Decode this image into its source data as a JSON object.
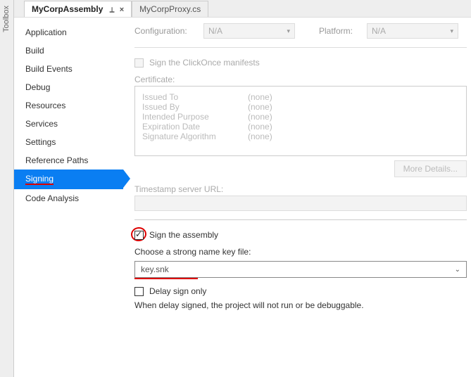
{
  "toolbox_label": "Toolbox",
  "tabs": [
    {
      "label": "MyCorpAssembly",
      "active": true,
      "pinned": true
    },
    {
      "label": "MyCorpProxy.cs",
      "active": false,
      "pinned": false
    }
  ],
  "sidebar": {
    "items": [
      "Application",
      "Build",
      "Build Events",
      "Debug",
      "Resources",
      "Services",
      "Settings",
      "Reference Paths",
      "Signing",
      "Code Analysis"
    ],
    "selected": "Signing"
  },
  "config": {
    "configuration_label": "Configuration:",
    "configuration_value": "N/A",
    "platform_label": "Platform:",
    "platform_value": "N/A"
  },
  "clickonce": {
    "sign_label": "Sign the ClickOnce manifests",
    "certificate_label": "Certificate:",
    "cert": {
      "issued_to_label": "Issued To",
      "issued_to_value": "(none)",
      "issued_by_label": "Issued By",
      "issued_by_value": "(none)",
      "intended_purpose_label": "Intended Purpose",
      "intended_purpose_value": "(none)",
      "expiration_date_label": "Expiration Date",
      "expiration_date_value": "(none)",
      "signature_algorithm_label": "Signature Algorithm",
      "signature_algorithm_value": "(none)"
    },
    "more_details_label": "More Details...",
    "timestamp_label": "Timestamp server URL:"
  },
  "assembly": {
    "sign_label": "Sign the assembly",
    "choose_key_label": "Choose a strong name key file:",
    "key_file_value": "key.snk",
    "delay_sign_label": "Delay sign only",
    "delay_sign_hint": "When delay signed, the project will not run or be debuggable."
  }
}
